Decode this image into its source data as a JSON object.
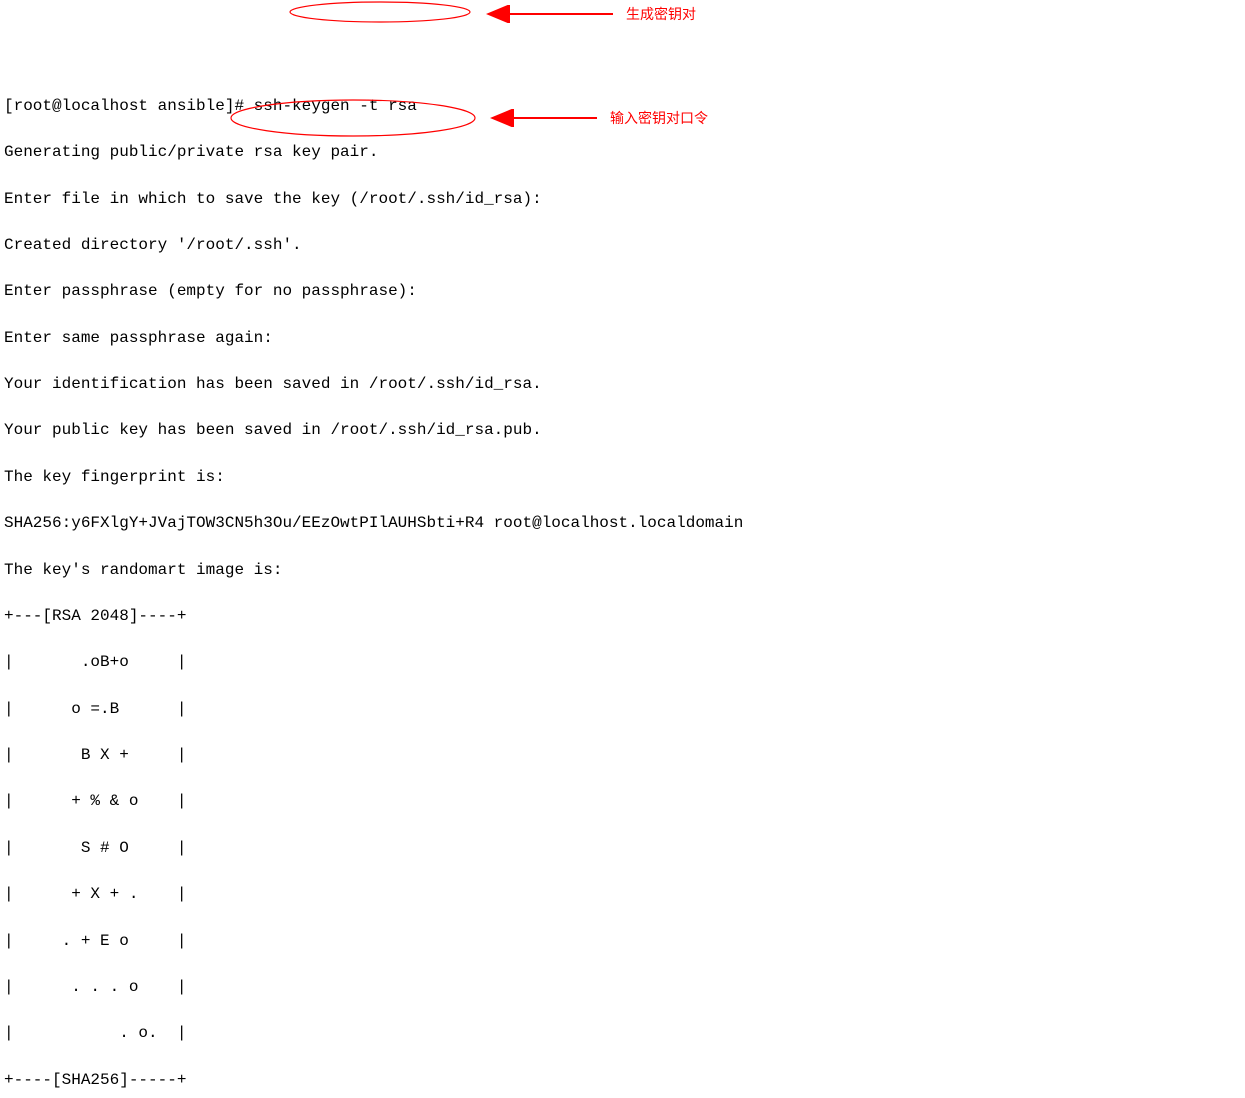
{
  "terminal": {
    "prompt": "[root@localhost ansible]# ",
    "command": "ssh-keygen -t rsa",
    "lines": [
      "Generating public/private rsa key pair.",
      "Enter file in which to save the key (/root/.ssh/id_rsa):",
      "Created directory '/root/.ssh'.",
      "Enter passphrase (empty for no passphrase):",
      "Enter same passphrase again:",
      "Your identification has been saved in /root/.ssh/id_rsa.",
      "Your public key has been saved in /root/.ssh/id_rsa.pub.",
      "The key fingerprint is:",
      "SHA256:y6FXlgY+JVajTOW3CN5h3Ou/EEzOwtPIlAUHSbti+R4 root@localhost.localdomain",
      "The key's randomart image is:",
      "+---[RSA 2048]----+",
      "|       .oB+o     |",
      "|      o =.B      |",
      "|       B X +     |",
      "|      + % & o    |",
      "|       S # O     |",
      "|      + X + .    |",
      "|     . + E o     |",
      "|      . . . o    |",
      "|           . o.  |",
      "+----[SHA256]-----+"
    ]
  },
  "annotations": {
    "note1": "生成密钥对",
    "note2": "输入密钥对口令"
  }
}
